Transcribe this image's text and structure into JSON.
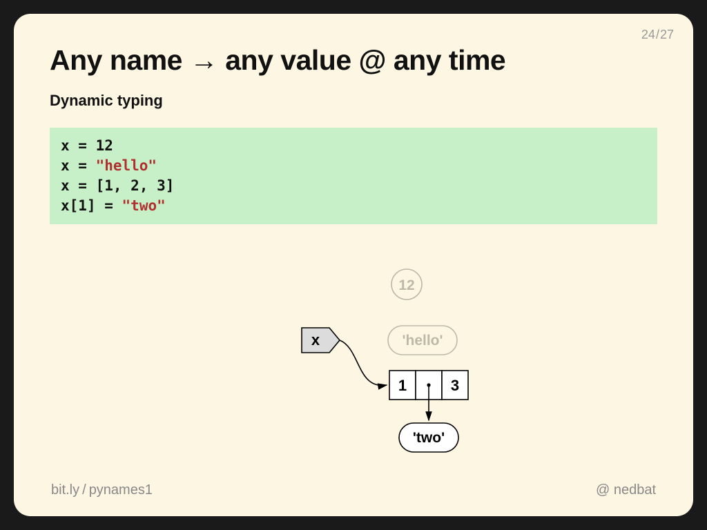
{
  "page": {
    "current": "24",
    "total": "27"
  },
  "title": "Any name → any value @ any time",
  "subtitle": "Dynamic typing",
  "code": {
    "line1_lhs": "x = ",
    "line1_val": "12",
    "line2_lhs": "x = ",
    "line2_val": "\"hello\"",
    "line3_lhs": "x = [",
    "line3_v1": "1",
    "line3_s1": ", ",
    "line3_v2": "2",
    "line3_s2": ", ",
    "line3_v3": "3",
    "line3_close": "]",
    "line4_lhs": "x[",
    "line4_idx": "1",
    "line4_mid": "] = ",
    "line4_val": "\"two\""
  },
  "diagram": {
    "name_label": "x",
    "faded_int": "12",
    "faded_str": "'hello'",
    "list_0": "1",
    "list_2": "3",
    "ref_str": "'two'"
  },
  "footer": {
    "left_domain": "bit.ly",
    "left_sep": "/",
    "left_path": "pynames1",
    "right_at": "@",
    "right_handle": "nedbat"
  }
}
